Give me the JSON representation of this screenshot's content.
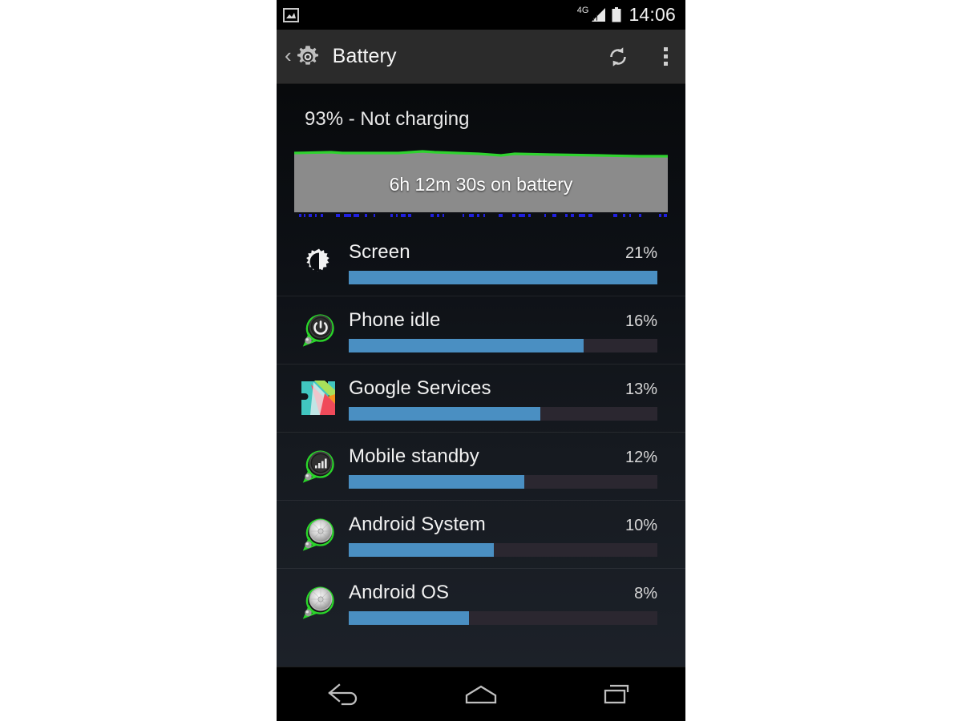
{
  "status_bar": {
    "notification_icon": "screenshot-icon",
    "network_label": "4G",
    "signal_icon": "signal-bars-icon",
    "battery_icon": "battery-full-icon",
    "clock": "14:06"
  },
  "action_bar": {
    "back_glyph": "‹",
    "app_icon": "settings-gear-icon",
    "title": "Battery",
    "refresh_icon": "refresh-icon",
    "overflow_icon": "overflow-menu-icon"
  },
  "summary": {
    "status_text": "93% - Not charging",
    "graph_label": "6h 12m 30s on battery",
    "battery_percent": 93,
    "graph_line_color": "#2fd32f",
    "graph_fill_color": "#8b8b8b",
    "graph_tick_color": "#1f1fe0"
  },
  "theme": {
    "accent_bar_color": "#4a8fc2",
    "track_color": "#2b2730",
    "action_bar_color": "#2b2b2b",
    "text_primary": "#f2f2f2",
    "text_secondary": "#d8d8d8"
  },
  "usage": {
    "items": [
      {
        "name": "Screen",
        "percent_label": "21%",
        "percent": 21,
        "bar_ratio": 100,
        "icon": "brightness-icon"
      },
      {
        "name": "Phone idle",
        "percent_label": "16%",
        "percent": 16,
        "bar_ratio": 76,
        "icon": "power-button-icon"
      },
      {
        "name": "Google Services",
        "percent_label": "13%",
        "percent": 13,
        "bar_ratio": 62,
        "icon": "google-play-services-icon"
      },
      {
        "name": "Mobile standby",
        "percent_label": "12%",
        "percent": 12,
        "bar_ratio": 57,
        "icon": "signal-bars-icon"
      },
      {
        "name": "Android System",
        "percent_label": "10%",
        "percent": 10,
        "bar_ratio": 47,
        "icon": "android-disc-icon"
      },
      {
        "name": "Android OS",
        "percent_label": "8%",
        "percent": 8,
        "bar_ratio": 39,
        "icon": "android-disc-icon"
      }
    ]
  },
  "nav_bar": {
    "back_label": "Back",
    "home_label": "Home",
    "recents_label": "Recent apps"
  }
}
